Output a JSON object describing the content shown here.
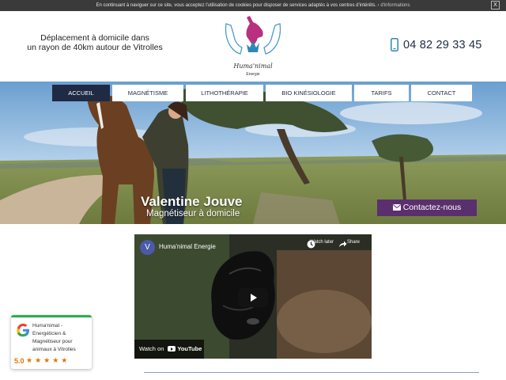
{
  "cookie_bar": {
    "text": "En continuant à naviguer sur ce site, vous acceptez l'utilisation de cookies pour disposer de services adaptés à vos centres d'intérêts.",
    "more_link": "› d'informations",
    "close_label": "X"
  },
  "header": {
    "tagline_line1": "Déplacement à domicile dans",
    "tagline_line2": "un rayon de 40km autour de Vitrolles",
    "logo_name": "Huma'nimal",
    "logo_sub": "Energie",
    "phone": "04 82 29 33 45",
    "phone_icon": "smartphone-icon"
  },
  "nav": {
    "items": [
      {
        "label": "ACCUEIL",
        "active": true
      },
      {
        "label": "MAGNÉTISME",
        "active": false
      },
      {
        "label": "LITHOTHÉRAPIE",
        "active": false
      },
      {
        "label": "BIO KINÉSIOLOGIE",
        "active": false
      },
      {
        "label": "TARIFS",
        "active": false
      },
      {
        "label": "CONTACT",
        "active": false
      }
    ]
  },
  "hero": {
    "name": "Valentine Jouve",
    "subtitle": "Magnétiseur à domicile",
    "contact_button": "Contactez-nous",
    "contact_icon": "envelope-icon"
  },
  "video": {
    "channel_initial": "V",
    "title": "Huma'nimal Energie",
    "watch_later": "Watch later",
    "share": "Share",
    "watch_on": "Watch on",
    "youtube": "YouTube"
  },
  "review": {
    "name": "Huma'nimal - Energéticien & Magnétiseur pour animaux à Vitrolles",
    "score": "5.0",
    "stars": "★★★★★",
    "stars_value": 5
  },
  "colors": {
    "nav_active": "#1f2a44",
    "contact_button": "#5a2f6e",
    "review_accent": "#34a853",
    "star": "#e37400"
  }
}
